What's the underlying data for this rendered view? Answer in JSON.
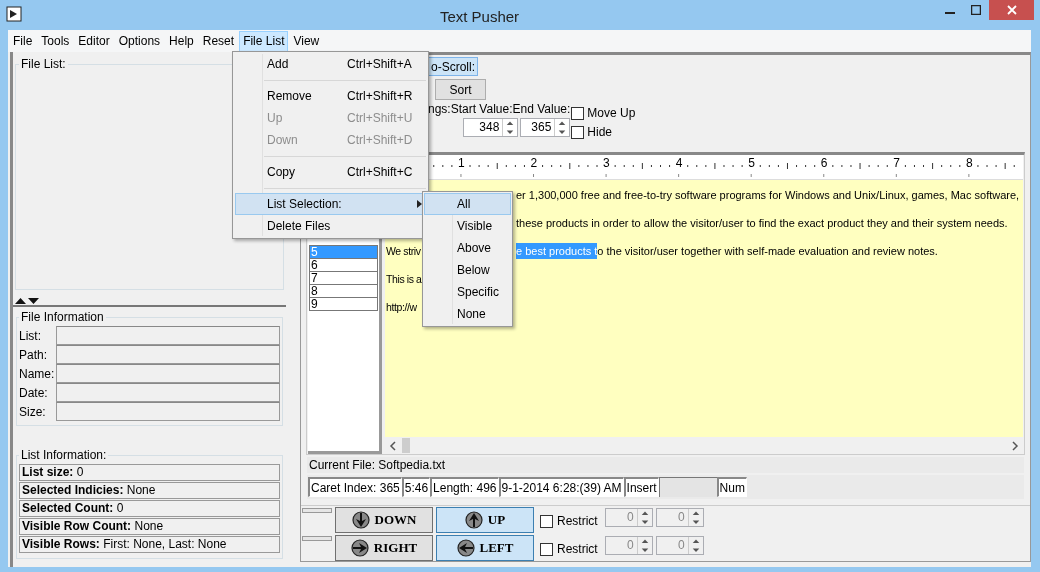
{
  "window": {
    "title": "Text Pusher"
  },
  "menu_bar": [
    {
      "label": "File",
      "selected": false
    },
    {
      "label": "Tools",
      "selected": false
    },
    {
      "label": "Editor",
      "selected": false
    },
    {
      "label": "Options",
      "selected": false
    },
    {
      "label": "Help",
      "selected": false
    },
    {
      "label": "Reset",
      "selected": false
    },
    {
      "label": "File List",
      "selected": true
    },
    {
      "label": "View",
      "selected": false
    }
  ],
  "file_list_menu": [
    {
      "kind": "item",
      "label": "Add",
      "shortcut": "Ctrl+Shift+A",
      "disabled": false
    },
    {
      "kind": "separator"
    },
    {
      "kind": "item",
      "label": "Remove",
      "shortcut": "Ctrl+Shift+R",
      "disabled": false
    },
    {
      "kind": "item",
      "label": "Up",
      "shortcut": "Ctrl+Shift+U",
      "disabled": true
    },
    {
      "kind": "item",
      "label": "Down",
      "shortcut": "Ctrl+Shift+D",
      "disabled": true
    },
    {
      "kind": "separator"
    },
    {
      "kind": "item",
      "label": "Copy",
      "shortcut": "Ctrl+Shift+C",
      "disabled": false
    },
    {
      "kind": "separator"
    },
    {
      "kind": "submenu",
      "label": "List Selection:",
      "selected": true
    },
    {
      "kind": "item",
      "label": "Delete Files",
      "disabled": false
    }
  ],
  "list_selection_submenu": [
    {
      "label": "All",
      "selected": true
    },
    {
      "label": "Visible",
      "selected": false
    },
    {
      "label": "Above",
      "selected": false
    },
    {
      "label": "Below",
      "selected": false
    },
    {
      "label": "Specific",
      "selected": false
    },
    {
      "label": "None",
      "selected": false
    }
  ],
  "left_panel": {
    "file_list_title": "File List:",
    "file_information": {
      "title": "File Information",
      "fields": [
        "List:",
        "Path:",
        "Name:",
        "Date:",
        "Size:"
      ]
    },
    "list_information": {
      "title": "List Information:",
      "rows": [
        {
          "label": "List size:",
          "value": "0"
        },
        {
          "label": "Selected Indicies:",
          "value": "None"
        },
        {
          "label": "Selected Count:",
          "value": "0"
        },
        {
          "label": "Visible Row Count:",
          "value": "None"
        },
        {
          "label": "Visible Rows:",
          "value": "First: None, Last: None"
        }
      ]
    }
  },
  "toolbar": {
    "scroll_button": {
      "label": "o-Scroll:",
      "active": true
    },
    "sort_button": "Sort",
    "range_label": "ngs:Start Value:End Value:",
    "start_value": "348",
    "end_value": "365",
    "checkboxes": [
      {
        "label": "Move Up",
        "checked": false
      },
      {
        "label": "Hide",
        "checked": false
      }
    ]
  },
  "ruler": {
    "labels": [
      "1",
      "2",
      "3",
      "4",
      "5",
      "6",
      "7",
      "8"
    ]
  },
  "line_list": [
    {
      "label": "5",
      "selected": true
    },
    {
      "label": "6",
      "selected": false
    },
    {
      "label": "7",
      "selected": false
    },
    {
      "label": "8",
      "selected": false
    },
    {
      "label": "9",
      "selected": false
    }
  ],
  "editor_lines": [
    {
      "after": [
        {
          "text": "er 1,300,000 free and free-to-try software programs for Windows and Unix/Linux, games, Mac software,",
          "selected": false
        }
      ]
    },
    {
      "after": [
        {
          "text": "these products in order to allow the visitor/user to find the exact product they and their system needs.",
          "selected": false
        }
      ]
    },
    {
      "before": "We striv",
      "after": [
        {
          "text": "e best products t",
          "selected": true
        },
        {
          "text": "o the visitor/user together with self-made evaluation and review notes.",
          "selected": false
        }
      ]
    },
    {
      "before": "This is a"
    },
    {
      "before": "http://w"
    }
  ],
  "current_file": "Current File: Softpedia.txt",
  "status_bar": [
    "Caret Index: 365",
    "5:46",
    "Length: 496",
    "9-1-2014 6:28:(39) AM",
    "Insert",
    "Num"
  ],
  "move_rows": [
    {
      "buttons": [
        {
          "label": "DOWN",
          "kind": "down",
          "active": false
        },
        {
          "label": "UP",
          "kind": "up",
          "active": true
        }
      ],
      "restrict": {
        "label": "Restrict",
        "checked": false
      },
      "values": [
        "0",
        "0"
      ]
    },
    {
      "buttons": [
        {
          "label": "RIGHT",
          "kind": "right",
          "active": false
        },
        {
          "label": "LEFT",
          "kind": "left",
          "active": true
        }
      ],
      "restrict": {
        "label": "Restrict",
        "checked": false
      },
      "values": [
        "0",
        "0"
      ]
    }
  ]
}
